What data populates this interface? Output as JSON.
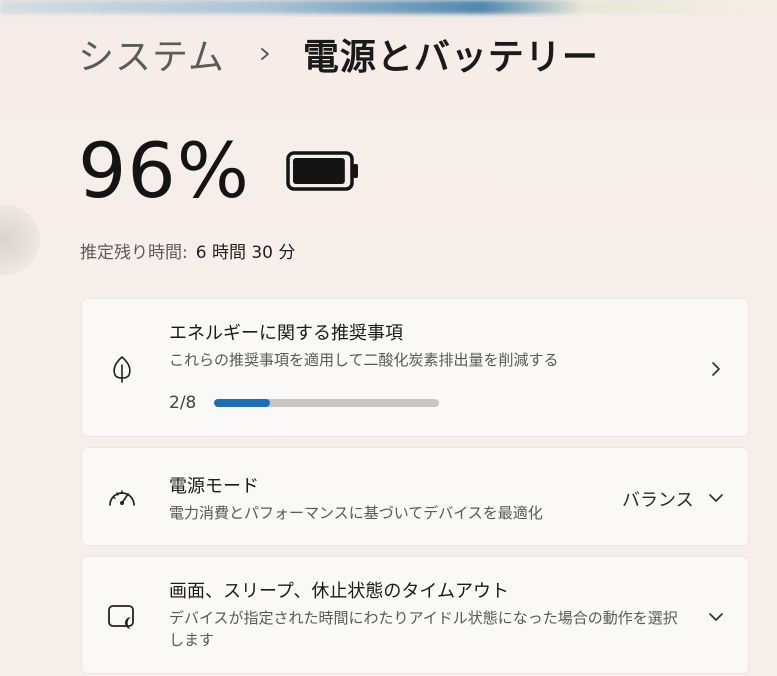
{
  "breadcrumb": {
    "parent": "システム",
    "current": "電源とバッテリー"
  },
  "battery": {
    "percent_text": "96%",
    "level": 0.96,
    "remaining_label": "推定残り時間:",
    "remaining_value": "6 時間 30 分"
  },
  "cards": {
    "recommendations": {
      "title": "エネルギーに関する推奨事項",
      "subtitle": "これらの推奨事項を適用して二酸化炭素排出量を削減する",
      "progress_text": "2/8",
      "progress_fraction": 0.25,
      "icon": "leaf-icon"
    },
    "power_mode": {
      "title": "電源モード",
      "subtitle": "電力消費とパフォーマンスに基づいてデバイスを最適化",
      "selected_value": "バランス",
      "icon": "gauge-icon"
    },
    "screen_sleep": {
      "title": "画面、スリープ、休止状態のタイムアウト",
      "subtitle": "デバイスが指定された時間にわたりアイドル状態になった場合の動作を選択します",
      "icon": "screen-sleep-icon"
    }
  },
  "colors": {
    "accent": "#1d6fb3",
    "card_bg": "#fbf9f8",
    "page_bg": "#f6ece7"
  }
}
